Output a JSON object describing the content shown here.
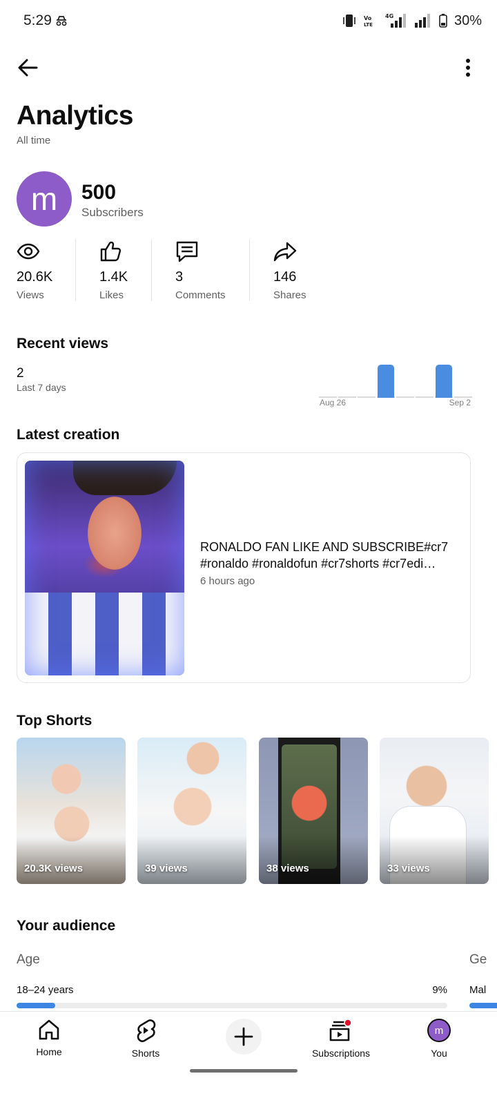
{
  "status_bar": {
    "time": "5:29",
    "battery": "30%",
    "network": "4G",
    "volte": "Vo LTE"
  },
  "header": {
    "title": "Analytics",
    "subtitle": "All time"
  },
  "channel": {
    "avatar_letter": "m",
    "avatar_color": "#8e5cc9",
    "subscribers": "500",
    "subscribers_label": "Subscribers"
  },
  "stats": [
    {
      "value": "20.6K",
      "label": "Views",
      "icon": "eye-icon"
    },
    {
      "value": "1.4K",
      "label": "Likes",
      "icon": "thumbs-up-icon"
    },
    {
      "value": "3",
      "label": "Comments",
      "icon": "comment-icon"
    },
    {
      "value": "146",
      "label": "Shares",
      "icon": "share-icon"
    }
  ],
  "recent_views": {
    "title": "Recent views",
    "value": "2",
    "period": "Last 7 days"
  },
  "chart_data": {
    "type": "bar",
    "categories": [
      "Aug 26",
      "Aug 27",
      "Aug 28",
      "Aug 29",
      "Aug 30",
      "Aug 31",
      "Sep 1",
      "Sep 2"
    ],
    "values": [
      0,
      0,
      0,
      1,
      0,
      0,
      1,
      0
    ],
    "x_tick_labels": [
      "Aug 26",
      "Sep 2"
    ],
    "bar_color": "#4a8de0"
  },
  "latest_creation": {
    "title": "Latest creation",
    "video_title_line1": "RONALDO FAN LIKE AND SUBSCRIBE#cr7",
    "video_title_line2": "#ronaldo #ronaldofun #cr7shorts #cr7edi…",
    "time": "6 hours ago"
  },
  "top_shorts": {
    "title": "Top Shorts",
    "items": [
      {
        "views": "20.3K views"
      },
      {
        "views": "39 views"
      },
      {
        "views": "38 views"
      },
      {
        "views": "33 views"
      }
    ]
  },
  "audience": {
    "title": "Your audience",
    "age_label": "Age",
    "gender_label_partial": "Ge",
    "age_range": "18–24 years",
    "age_percent": "9%",
    "age_fraction": 0.09,
    "gender_first_partial": "Mal"
  },
  "bottom_nav": {
    "home": "Home",
    "shorts": "Shorts",
    "subscriptions": "Subscriptions",
    "you": "You",
    "you_avatar_letter": "m",
    "notification_dot_color": "#e0102b"
  }
}
